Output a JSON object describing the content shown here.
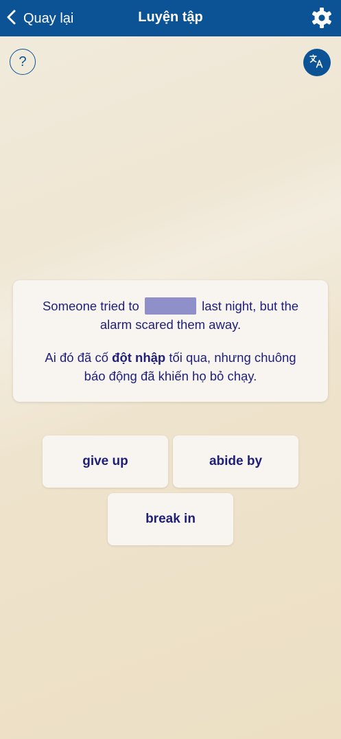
{
  "header": {
    "back_label": "Quay lại",
    "title": "Luyện tập",
    "help_label": "?"
  },
  "question": {
    "en_before": "Someone tried to",
    "en_after": "last night, but the alarm scared them away.",
    "vi_before": "Ai đó đã cố",
    "vi_highlight": "đột nhập",
    "vi_after": "tối qua, nhưng chuông báo động đã khiến họ bỏ chạy."
  },
  "options": [
    "give up",
    "abide by",
    "break in"
  ],
  "colors": {
    "header_bg": "#0b5395",
    "text": "#1f1f7a",
    "blank": "#8f90c9"
  }
}
